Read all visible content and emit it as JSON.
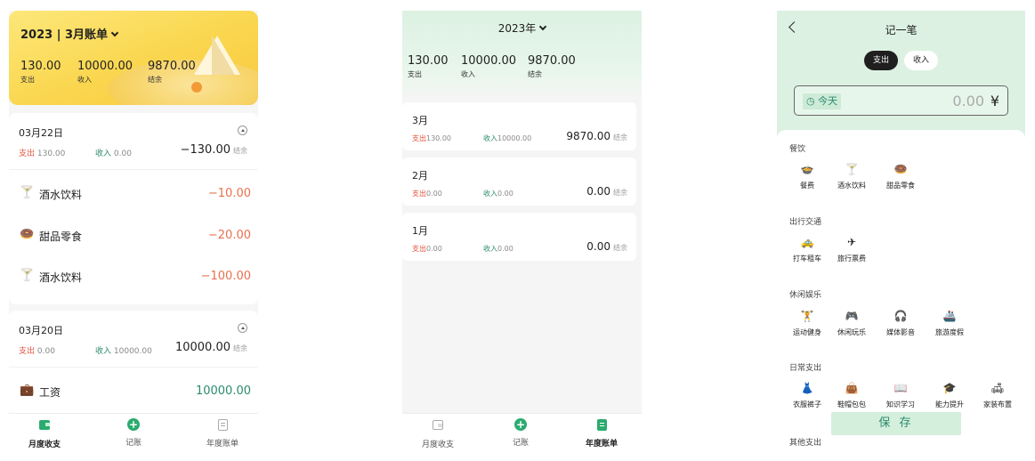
{
  "screen1": {
    "header": {
      "title": "2023 | 3月账单",
      "summary": [
        {
          "value": "130.00",
          "label": "支出"
        },
        {
          "value": "10000.00",
          "label": "收入"
        },
        {
          "value": "9870.00",
          "label": "结余"
        }
      ]
    },
    "days": [
      {
        "date": "03月22日",
        "out_label": "支出",
        "out_value": "130.00",
        "in_label": "收入",
        "in_value": "0.00",
        "balance": "−130.00",
        "balance_unit": "结余",
        "items": [
          {
            "icon": "cocktail-icon",
            "glyph": "🍸",
            "name": "酒水饮料",
            "amount": "−10.00"
          },
          {
            "icon": "dessert-icon",
            "glyph": "🍩",
            "name": "甜品零食",
            "amount": "−20.00"
          },
          {
            "icon": "cocktail-icon",
            "glyph": "🍸",
            "name": "酒水饮料",
            "amount": "−100.00"
          }
        ]
      },
      {
        "date": "03月20日",
        "out_label": "支出",
        "out_value": "0.00",
        "in_label": "收入",
        "in_value": "10000.00",
        "balance": "10000.00",
        "balance_unit": "结余",
        "items": [
          {
            "icon": "salary-icon",
            "glyph": "💼",
            "name": "工资",
            "amount": "10000.00"
          }
        ]
      }
    ],
    "tabs": [
      "月度收支",
      "记账",
      "年度账单"
    ]
  },
  "screen2": {
    "year": "2023年",
    "summary": [
      {
        "value": "130.00",
        "label": "支出"
      },
      {
        "value": "10000.00",
        "label": "收入"
      },
      {
        "value": "9870.00",
        "label": "结余"
      }
    ],
    "months": [
      {
        "month": "3月",
        "out_label": "支出",
        "out_value": "130.00",
        "in_label": "收入",
        "in_value": "10000.00",
        "balance": "9870.00",
        "balance_unit": "结余"
      },
      {
        "month": "2月",
        "out_label": "支出",
        "out_value": "0.00",
        "in_label": "收入",
        "in_value": "0.00",
        "balance": "0.00",
        "balance_unit": "结余"
      },
      {
        "month": "1月",
        "out_label": "支出",
        "out_value": "0.00",
        "in_label": "收入",
        "in_value": "0.00",
        "balance": "0.00",
        "balance_unit": "结余"
      }
    ],
    "tabs": [
      "月度收支",
      "记账",
      "年度账单"
    ]
  },
  "screen3": {
    "title": "记一笔",
    "type_tabs": [
      "支出",
      "收入"
    ],
    "date_chip": "今天",
    "amount_placeholder": "0.00",
    "currency": "¥",
    "categories": [
      {
        "name": "餐饮",
        "items": [
          {
            "label": "餐费",
            "icon": "meal-icon",
            "glyph": "🍲"
          },
          {
            "label": "酒水饮料",
            "icon": "cocktail-icon",
            "glyph": "🍸"
          },
          {
            "label": "甜品零食",
            "icon": "dessert-icon",
            "glyph": "🍩"
          }
        ]
      },
      {
        "name": "出行交通",
        "items": [
          {
            "label": "打车租车",
            "icon": "taxi-icon",
            "glyph": "🚕"
          },
          {
            "label": "旅行票费",
            "icon": "ticket-icon",
            "glyph": "✈"
          }
        ]
      },
      {
        "name": "休闲娱乐",
        "items": [
          {
            "label": "运动健身",
            "icon": "dumbbell-icon",
            "glyph": "🏋"
          },
          {
            "label": "休闲玩乐",
            "icon": "gamepad-icon",
            "glyph": "🎮"
          },
          {
            "label": "媒体影音",
            "icon": "headphones-icon",
            "glyph": "🎧"
          },
          {
            "label": "旅游度假",
            "icon": "ship-icon",
            "glyph": "🚢"
          }
        ]
      },
      {
        "name": "日常支出",
        "items": [
          {
            "label": "衣服裤子",
            "icon": "dress-icon",
            "glyph": "👗"
          },
          {
            "label": "鞋帽包包",
            "icon": "bag-icon",
            "glyph": "👜"
          },
          {
            "label": "知识学习",
            "icon": "book-icon",
            "glyph": "📖"
          },
          {
            "label": "能力提升",
            "icon": "graduation-icon",
            "glyph": "🎓"
          },
          {
            "label": "家装布置",
            "icon": "furniture-icon",
            "glyph": "🛋"
          }
        ]
      },
      {
        "name": "其他支出",
        "items": []
      }
    ],
    "save_label": "保 存"
  }
}
